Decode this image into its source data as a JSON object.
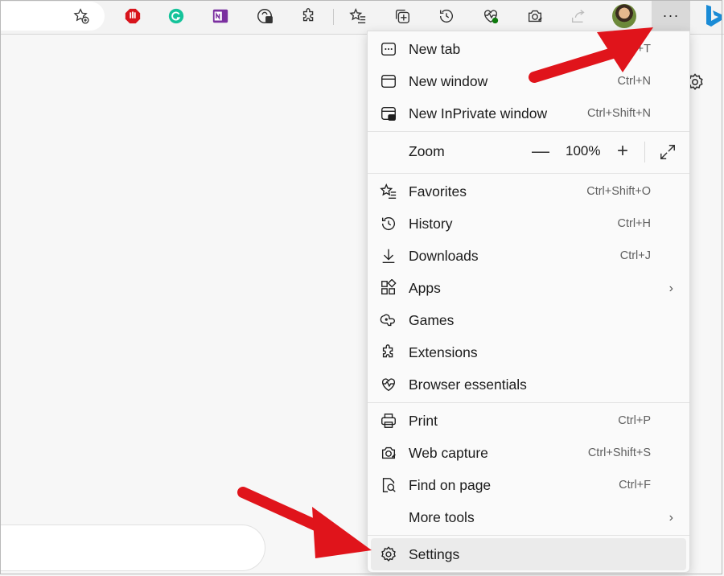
{
  "toolbar": {
    "icons": [
      "favorites-add-icon",
      "adblock-extension-icon",
      "grammarly-extension-icon",
      "onenote-extension-icon",
      "password-extension-icon",
      "extensions-icon",
      "favorites-icon",
      "collections-icon",
      "history-icon",
      "browser-essentials-icon",
      "web-capture-icon",
      "share-icon",
      "profile-avatar",
      "more-options-icon",
      "bing-icon"
    ],
    "more_label": "···"
  },
  "menu": {
    "new_tab": {
      "label": "New tab",
      "shortcut": "Ctrl+T"
    },
    "new_window": {
      "label": "New window",
      "shortcut": "Ctrl+N"
    },
    "new_inprivate": {
      "label": "New InPrivate window",
      "shortcut": "Ctrl+Shift+N"
    },
    "zoom": {
      "label": "Zoom",
      "minus": "—",
      "value": "100%",
      "plus": "+"
    },
    "favorites": {
      "label": "Favorites",
      "shortcut": "Ctrl+Shift+O"
    },
    "history": {
      "label": "History",
      "shortcut": "Ctrl+H"
    },
    "downloads": {
      "label": "Downloads",
      "shortcut": "Ctrl+J"
    },
    "apps": {
      "label": "Apps"
    },
    "games": {
      "label": "Games"
    },
    "extensions": {
      "label": "Extensions"
    },
    "browser_essentials": {
      "label": "Browser essentials"
    },
    "print": {
      "label": "Print",
      "shortcut": "Ctrl+P"
    },
    "web_capture": {
      "label": "Web capture",
      "shortcut": "Ctrl+Shift+S"
    },
    "find_on_page": {
      "label": "Find on page",
      "shortcut": "Ctrl+F"
    },
    "more_tools": {
      "label": "More tools"
    },
    "settings": {
      "label": "Settings"
    }
  },
  "colors": {
    "arrow": "#e0141b",
    "menu_bg": "#fafafa",
    "highlight": "#ebebeb",
    "more_button_bg": "#d9d9d9"
  }
}
